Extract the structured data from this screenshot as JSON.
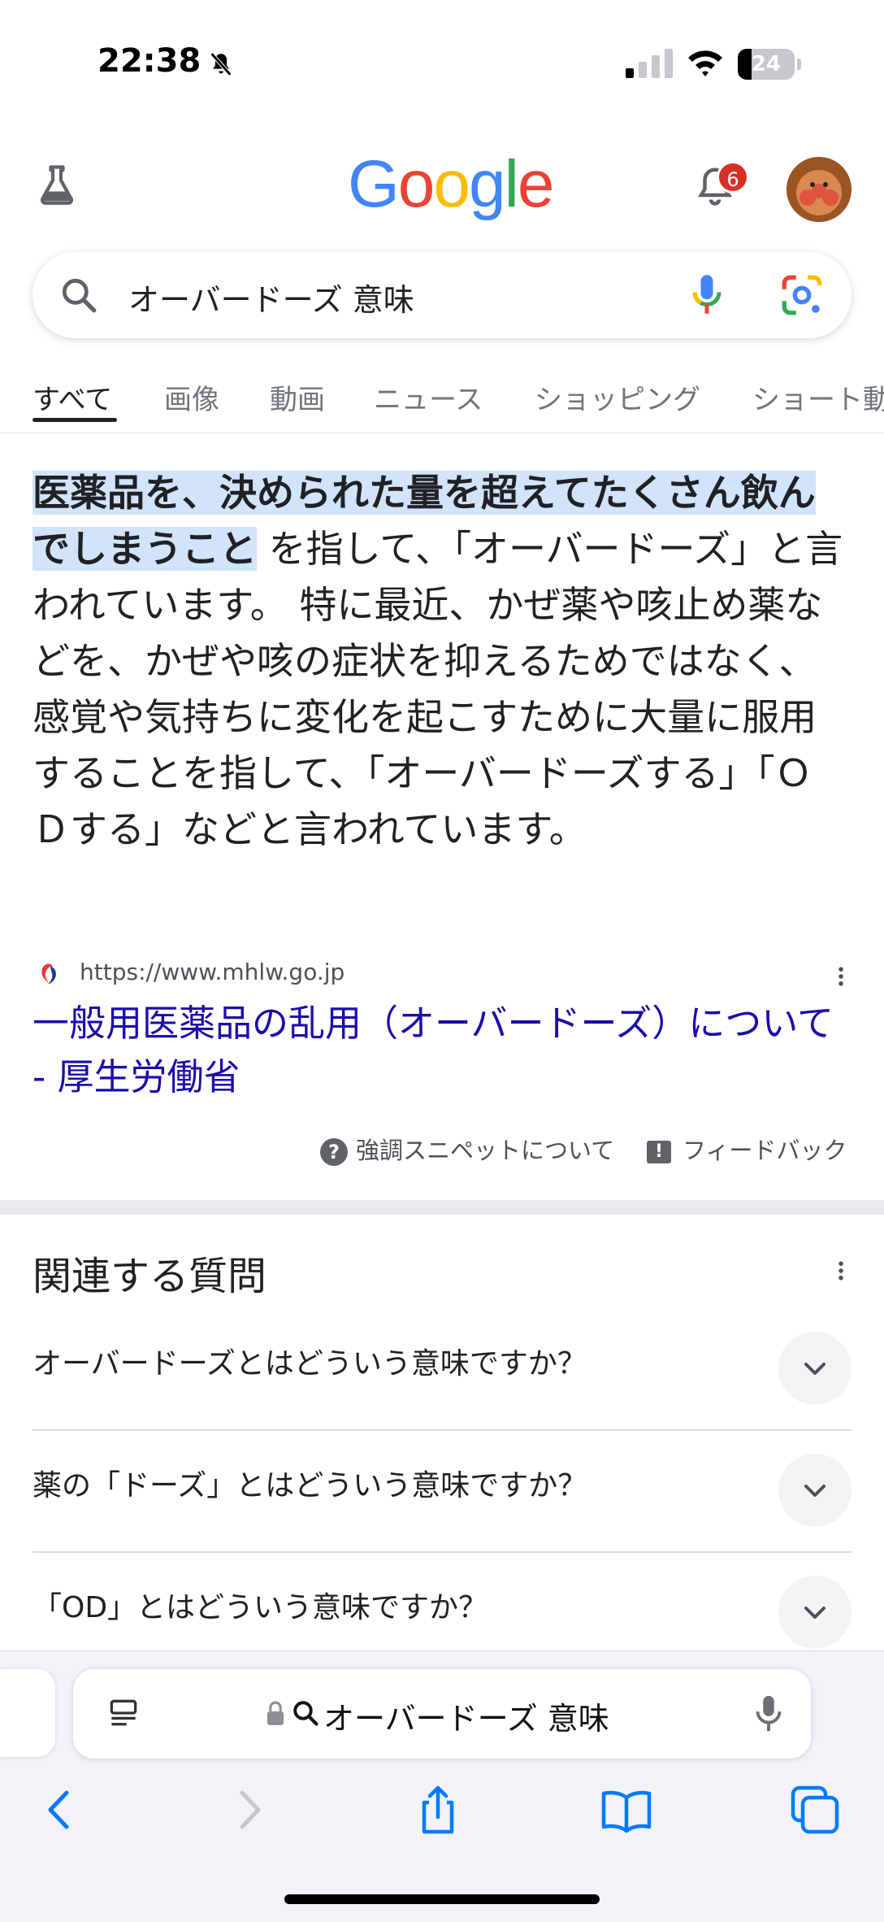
{
  "status_bar": {
    "time": "22:38",
    "battery": "24",
    "battery_percent": 24
  },
  "header": {
    "logo_letters": [
      {
        "ch": "G",
        "color": "#4285F4"
      },
      {
        "ch": "o",
        "color": "#EA4335"
      },
      {
        "ch": "o",
        "color": "#FBBC05"
      },
      {
        "ch": "g",
        "color": "#4285F4"
      },
      {
        "ch": "l",
        "color": "#34A853"
      },
      {
        "ch": "e",
        "color": "#EA4335"
      }
    ],
    "notification_count": "6"
  },
  "search": {
    "query": "オーバードーズ 意味"
  },
  "tabs": [
    {
      "label": "すべて",
      "active": true
    },
    {
      "label": "画像",
      "active": false
    },
    {
      "label": "動画",
      "active": false
    },
    {
      "label": "ニュース",
      "active": false
    },
    {
      "label": "ショッピング",
      "active": false
    },
    {
      "label": "ショート動画",
      "active": false
    }
  ],
  "featured_snippet": {
    "highlight_text": "医薬品を、決められた量を超えてたくさん飲んでしまうこと",
    "body_text": "を指して、「オーバードーズ」と言われています。 特に最近、かぜ薬や咳止め薬などを、かぜや咳の症状を抑えるためではなく、感覚や気持ちに変化を起こすために大量に服用することを指して、「オーバードーズする」「ＯＤする」などと言われています。",
    "source_url": "https://www.mhlw.go.jp",
    "result_title": "一般用医薬品の乱用（オーバードーズ）について - 厚生労働省",
    "about_label": "強調スニペットについて",
    "feedback_label": "フィードバック"
  },
  "related_questions": {
    "title": "関連する質問",
    "items": [
      "オーバードーズとはどういう意味ですか？",
      "薬の「ドーズ」とはどういう意味ですか？",
      "「OD」とはどういう意味ですか？"
    ]
  },
  "safari": {
    "address_text": "オーバードーズ 意味"
  },
  "colors": {
    "link": "#1a0dab",
    "highlight": "#d2e3fc",
    "badge": "#d93025",
    "ios_blue": "#007aff"
  }
}
